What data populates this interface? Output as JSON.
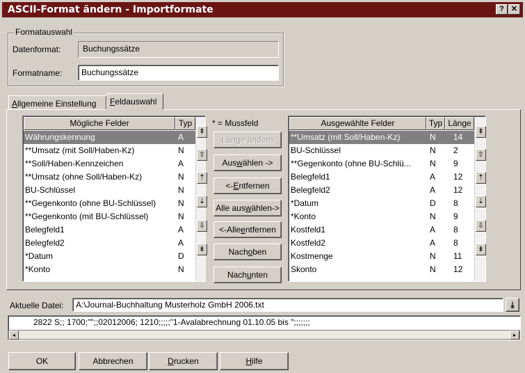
{
  "window": {
    "title": "ASCII-Format ändern - Importformate",
    "help_label": "?",
    "close_label": "✕"
  },
  "formatauswahl": {
    "legend": "Formatauswahl",
    "datenformat_label": "Datenformat:",
    "datenformat_value": "Buchungssätze",
    "formatname_label": "Formatname:",
    "formatname_value": "Buchungssätze"
  },
  "tabs": [
    {
      "label": "Allgemeine Einstellung",
      "accel": "A",
      "rest": "llgemeine Einstellung"
    },
    {
      "label": "Feldauswahl",
      "accel": "F",
      "rest": "eldauswahl"
    }
  ],
  "left_list": {
    "col_name": "Mögliche Felder",
    "col_type": "Typ",
    "rows": [
      {
        "name": "Währungskennung",
        "type": "A"
      },
      {
        "name": "**Umsatz (mit Soll/Haben-Kz)",
        "type": "N"
      },
      {
        "name": "**Soll/Haben-Kennzeichen",
        "type": "A"
      },
      {
        "name": "**Umsatz (ohne Soll/Haben-Kz)",
        "type": "N"
      },
      {
        "name": "BU-Schlüssel",
        "type": "N"
      },
      {
        "name": "**Gegenkonto (ohne BU-Schlüssel)",
        "type": "N"
      },
      {
        "name": "**Gegenkonto (mit BU-Schlüssel)",
        "type": "N"
      },
      {
        "name": "Belegfeld1",
        "type": "A"
      },
      {
        "name": "Belegfeld2",
        "type": "A"
      },
      {
        "name": "*Datum",
        "type": "D"
      },
      {
        "name": "*Konto",
        "type": "N"
      }
    ]
  },
  "mussfeld_note": "* = Mussfeld",
  "buttons": {
    "laenge_aendern": "Länge ändern",
    "auswaehlen_pre": "Aus",
    "auswaehlen_acc": "w",
    "auswaehlen_post": "ählen ->",
    "entfernen_pre": "<-",
    "entfernen_acc": "E",
    "entfernen_post": "ntfernen",
    "alle_auswaehlen_pre": "Alle aus",
    "alle_auswaehlen_acc": "w",
    "alle_auswaehlen_post": "ählen->",
    "alle_entfernen_pre": "<-Alle ",
    "alle_entfernen_acc": "e",
    "alle_entfernen_post": "ntfernen",
    "nach_oben_pre": "Nach ",
    "nach_oben_acc": "o",
    "nach_oben_post": "ben",
    "nach_unten_pre": "Nach ",
    "nach_unten_acc": "u",
    "nach_unten_post": "nten"
  },
  "right_list": {
    "col_name": "Ausgewählte Felder",
    "col_type": "Typ",
    "col_len": "Länge",
    "rows": [
      {
        "name": "**Umsatz (mit Soll/Haben-Kz)",
        "type": "N",
        "len": "14"
      },
      {
        "name": "BU-Schlüssel",
        "type": "N",
        "len": "2"
      },
      {
        "name": "**Gegenkonto (ohne BU-Schlü...",
        "type": "N",
        "len": "9"
      },
      {
        "name": "Belegfeld1",
        "type": "A",
        "len": "12"
      },
      {
        "name": "Belegfeld2",
        "type": "A",
        "len": "12"
      },
      {
        "name": "*Datum",
        "type": "D",
        "len": "8"
      },
      {
        "name": "*Konto",
        "type": "N",
        "len": "9"
      },
      {
        "name": "Kostfeld1",
        "type": "A",
        "len": "8"
      },
      {
        "name": "Kostfeld2",
        "type": "A",
        "len": "8"
      },
      {
        "name": "Kostmenge",
        "type": "N",
        "len": "11"
      },
      {
        "name": "Skonto",
        "type": "N",
        "len": "12"
      }
    ]
  },
  "icons": {
    "top": "top-icon",
    "up": "up-icon",
    "down": "down-icon",
    "bottom": "bottom-icon",
    "browse": "download-icon",
    "scroll_left": "scroll-left-icon",
    "scroll_right": "scroll-right-icon"
  },
  "file": {
    "label": "Aktuelle Datei:",
    "value": "A:\\Journal-Buchhaltung Musterholz GmbH 2006.txt",
    "preview": "2822 S;;     1700;\"\";;02012006;     1210;;;;;\"1-Avalabrechnung 01.10.05 bis \";;;;;;;"
  },
  "footer": {
    "ok": "OK",
    "abbrechen": "Abbrechen",
    "drucken_acc": "D",
    "drucken_post": "rucken",
    "hilfe_acc": "H",
    "hilfe_post": "ilfe"
  },
  "colors": {
    "title_bg": "#6b1414",
    "face": "#d4d0c8",
    "selection": "#808080"
  }
}
